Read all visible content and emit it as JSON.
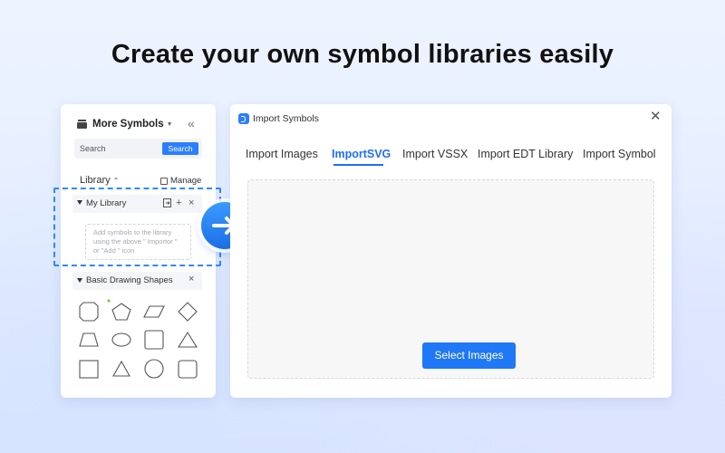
{
  "headline": "Create your own symbol libraries easily",
  "left_panel": {
    "title": "More Symbols",
    "search": {
      "placeholder": "Search",
      "button": "Search"
    },
    "library_label": "Library",
    "manage_label": "Manage",
    "my_library": {
      "name": "My Library",
      "hint_line1": "Add symbols to the library",
      "hint_line2": "using the above \" Importor \"",
      "hint_line3": "or  \"Add \" icon"
    },
    "basic_shapes": {
      "name": "Basic Drawing Shapes"
    }
  },
  "dialog": {
    "title": "Import Symbols",
    "tabs": [
      {
        "label": "Import Images"
      },
      {
        "label": "ImportSVG"
      },
      {
        "label": "Import VSSX"
      },
      {
        "label": "Import EDT Library"
      },
      {
        "label": "Import Symbol"
      }
    ],
    "active_tab": "ImportSVG",
    "select_button": "Select Images"
  },
  "colors": {
    "accent": "#1f78f5",
    "highlight_border": "#2d89ff"
  }
}
